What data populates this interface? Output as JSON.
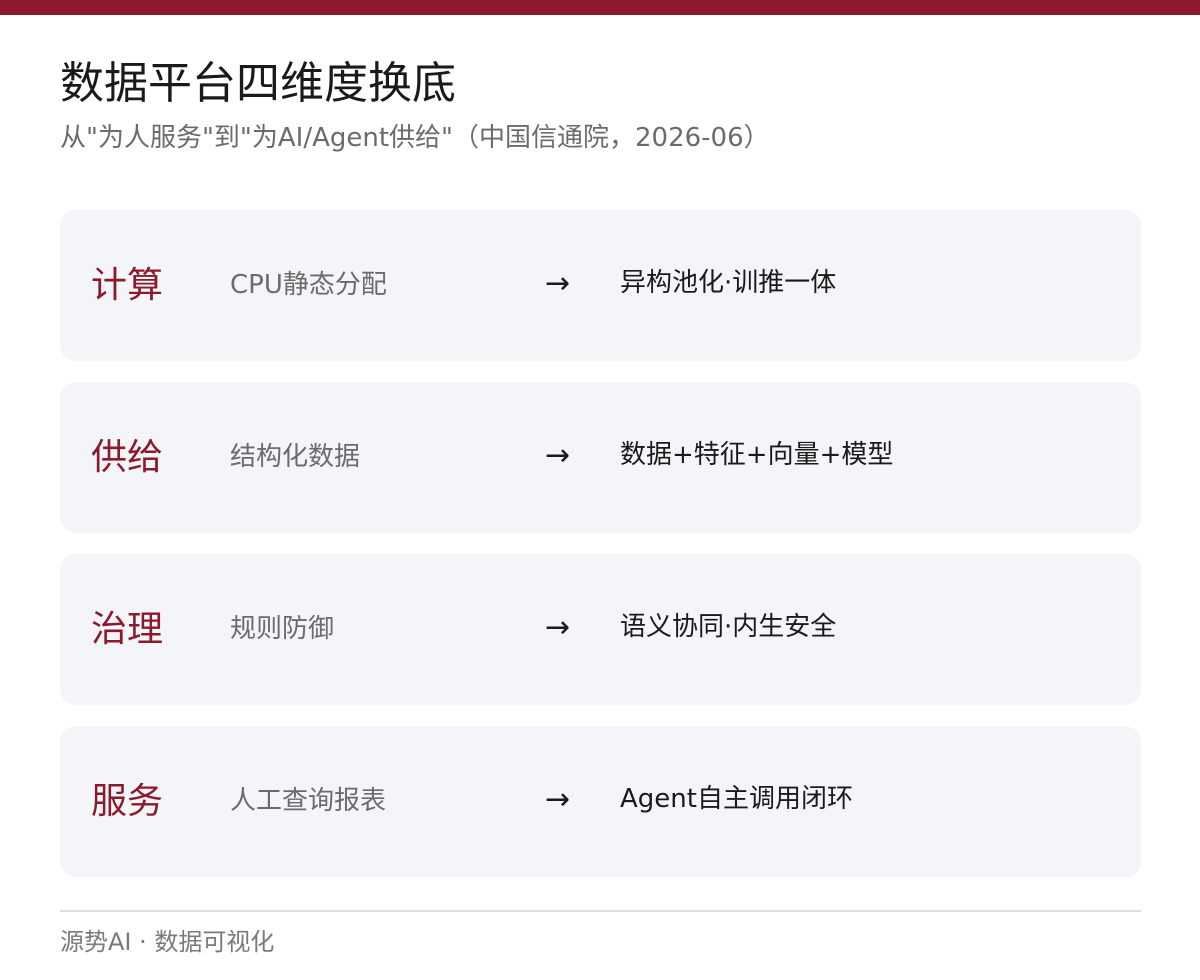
{
  "header": {
    "title": "数据平台四维度换底",
    "subtitle": "从\"为人服务\"到\"为AI/Agent供给\"（中国信通院，2026-06）"
  },
  "colors": {
    "accent": "#8c1a2c",
    "card_background": "#f4f5f9",
    "primary_text": "#1a1a1a",
    "secondary_text": "#6b6b6b"
  },
  "rows": [
    {
      "dimension": "计算",
      "before": "CPU静态分配",
      "arrow": "→",
      "after": "异构池化·训推一体"
    },
    {
      "dimension": "供给",
      "before": "结构化数据",
      "arrow": "→",
      "after": "数据+特征+向量+模型"
    },
    {
      "dimension": "治理",
      "before": "规则防御",
      "arrow": "→",
      "after": "语义协同·内生安全"
    },
    {
      "dimension": "服务",
      "before": "人工查询报表",
      "arrow": "→",
      "after": "Agent自主调用闭环"
    }
  ],
  "footer": {
    "source": "源势AI · 数据可视化"
  }
}
